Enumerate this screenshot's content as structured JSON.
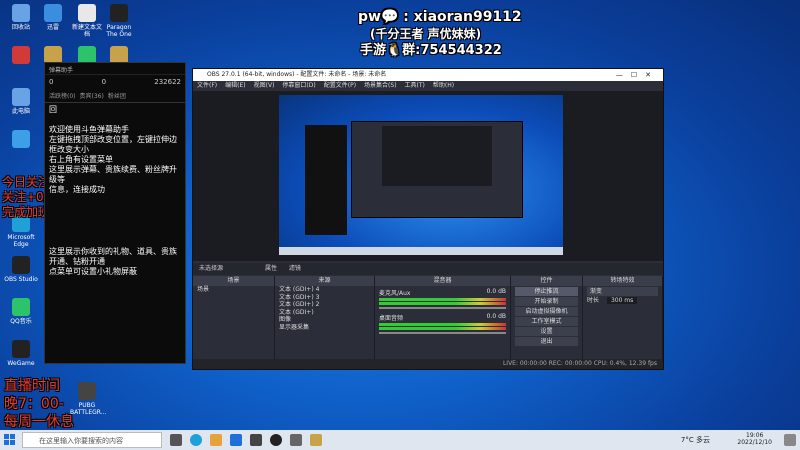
{
  "desktop_icons": [
    {
      "label": "回收站",
      "color": "#6aa2e6",
      "x": 0,
      "y": 0
    },
    {
      "label": "迅雷",
      "color": "#3b8de0",
      "x": 1,
      "y": 0
    },
    {
      "label": "新建文本文档",
      "color": "#e8e8e8",
      "x": 2,
      "y": 0
    },
    {
      "label": "Paragon The One",
      "color": "#222",
      "x": 3,
      "y": 0
    },
    {
      "label": "",
      "color": "#d23a3a",
      "x": 0,
      "y": 1
    },
    {
      "label": "",
      "color": "#c8a24a",
      "x": 1,
      "y": 1
    },
    {
      "label": "",
      "color": "#2cc36b",
      "x": 2,
      "y": 1
    },
    {
      "label": "",
      "color": "#c8a24a",
      "x": 3,
      "y": 1
    },
    {
      "label": "此电脑",
      "color": "#6aa2e6",
      "x": 0,
      "y": 2
    },
    {
      "label": "",
      "color": "#3ba0e8",
      "x": 0,
      "y": 3
    },
    {
      "label": "Microsoft Edge",
      "color": "#1fa1d8",
      "x": 0,
      "y": 5
    },
    {
      "label": "OBS Studio",
      "color": "#222",
      "x": 0,
      "y": 6
    },
    {
      "label": "QQ音乐",
      "color": "#2cc36b",
      "x": 0,
      "y": 7
    },
    {
      "label": "WeGame",
      "color": "#222",
      "x": 0,
      "y": 8
    },
    {
      "label": "",
      "color": "#e6a23c",
      "x": 1,
      "y": 8
    },
    {
      "label": "PUBG BATTLEGR...",
      "color": "#444",
      "x": 2,
      "y": 9
    }
  ],
  "overlays": {
    "pw_line": "pw💬 : xiaoran99112",
    "sub_line": "(千分王者 声优妹妹)",
    "group_line": "手游🐧群:754544322",
    "left_red_1": "今日关注",
    "left_red_2": "关注+0/100",
    "left_red_3": "完成加班",
    "schedule_1": "直播时间",
    "schedule_2": "晚7：00-",
    "schedule_3": "每周一休息"
  },
  "danmaku": {
    "title": "弹幕助手",
    "stats": [
      "0",
      "0",
      "232622"
    ],
    "tabs": [
      "活跃榜(0)",
      "贵宾(36)",
      "粉丝团"
    ],
    "messages": [
      "回",
      "欢迎使用斗鱼弹幕助手\n左键拖拽顶部改变位置，左键拉伸边框改变大小\n右上角有设置菜单\n这里展示弹幕、贵族续费、粉丝牌升级等\n信息，连接成功",
      "这里展示你收到的礼物、道具、贵族开通、钻粉开通\n点菜单可设置小礼物屏蔽"
    ]
  },
  "obs": {
    "title": "OBS 27.0.1 (64-bit, windows) - 配置文件: 未命名 - 场景: 未命名",
    "menu": [
      "文件(F)",
      "编辑(E)",
      "视图(V)",
      "停靠窗口(D)",
      "配置文件(P)",
      "场景集合(S)",
      "工具(T)",
      "帮助(H)"
    ],
    "source_bar_label": "未选择源",
    "source_tabs": [
      "属性",
      "滤镜"
    ],
    "docks": {
      "scenes": {
        "header": "场景",
        "items": [
          "场景"
        ]
      },
      "sources": {
        "header": "来源",
        "items": [
          "文本 (GDI+) 4",
          "文本 (GDI+) 3",
          "文本 (GDI+) 2",
          "文本 (GDI+)",
          "图像",
          "显示器采集"
        ]
      },
      "mixer": {
        "header": "混音器",
        "items": [
          {
            "name": "麦克风/Aux",
            "db": "0.0 dB"
          },
          {
            "name": "桌面音频",
            "db": "0.0 dB"
          }
        ]
      },
      "controls": {
        "header": "控件",
        "buttons": [
          "停止推流",
          "开始录制",
          "启动虚拟摄像机",
          "工作室模式",
          "设置",
          "退出"
        ]
      },
      "transitions": {
        "header": "转场特效",
        "type": "渐变",
        "duration_label": "时长",
        "duration": "300 ms"
      }
    },
    "status": "LIVE: 00:00:00  REC: 00:00:00  CPU: 0.4%, 12.39 fps"
  },
  "taskbar": {
    "search_placeholder": "在这里输入你要搜索的内容",
    "time": "19:06",
    "date": "2022/12/10",
    "weather": "7°C 多云"
  }
}
